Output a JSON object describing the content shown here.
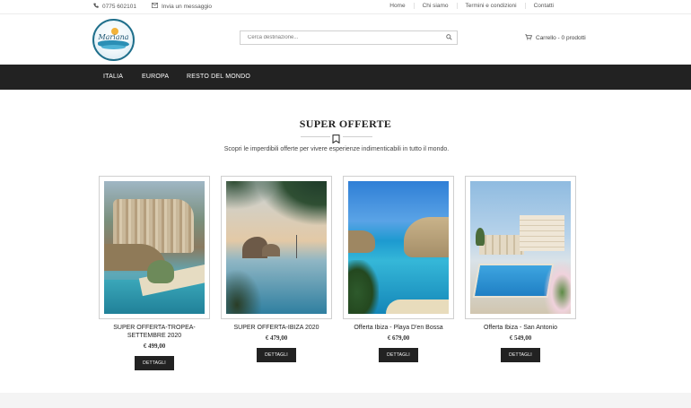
{
  "topbar": {
    "phone": "0775 602101",
    "message": "Invia un messaggio",
    "links": [
      "Home",
      "Chi siamo",
      "Termini e condizioni",
      "Contatti"
    ]
  },
  "header": {
    "logo_text": "Mariana",
    "search_placeholder": "Cerca destinazione...",
    "cart_label": "Carrello - 0 prodotti"
  },
  "nav": {
    "items": [
      "ITALIA",
      "EUROPA",
      "RESTO DEL MONDO"
    ]
  },
  "section": {
    "title": "SUPER OFFERTE",
    "subtitle": "Scopri le imperdibili offerte per vivere esperienze indimenticabili in tutto il mondo."
  },
  "products": [
    {
      "name": "SUPER OFFERTA-TROPEA-SETTEMBRE 2020",
      "price": "€  499,00",
      "button": "DETTAGLI"
    },
    {
      "name": "SUPER OFFERTA-IBIZA 2020",
      "price": "€  479,00",
      "button": "DETTAGLI"
    },
    {
      "name": "Offerta Ibiza - Playa D'en Bossa",
      "price": "€  679,00",
      "button": "DETTAGLI"
    },
    {
      "name": "Offerta Ibiza - San Antonio",
      "price": "€  549,00",
      "button": "DETTAGLI"
    }
  ],
  "colors": {
    "nav_bg": "#222222",
    "button_bg": "#222222",
    "page_bg": "#ffffff"
  },
  "icons": {
    "phone": "phone-icon",
    "message": "envelope-icon",
    "search": "search-icon",
    "cart": "cart-icon",
    "divider": "bookmark-icon"
  }
}
